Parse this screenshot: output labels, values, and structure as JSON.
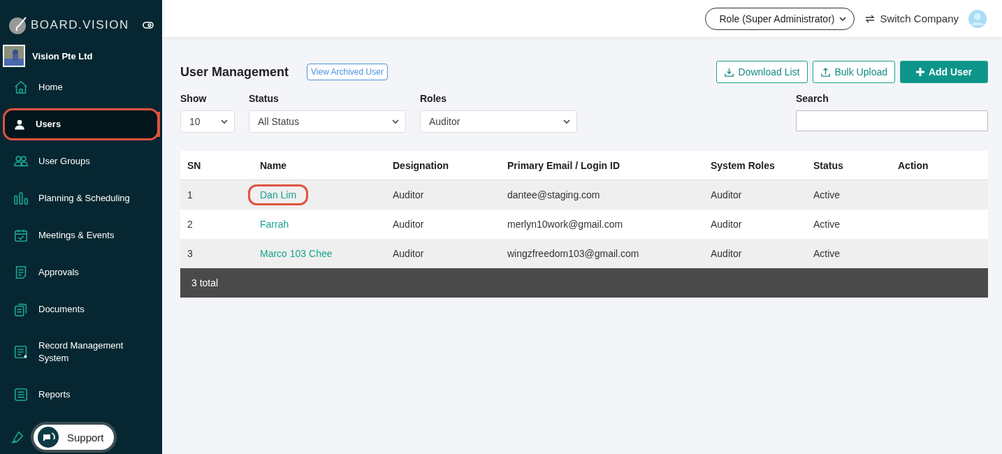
{
  "sidebar": {
    "brand": "BOARD.VISION",
    "company": "Vision Pte Ltd",
    "items": [
      {
        "label": "Home",
        "selected": false,
        "highlighted": false
      },
      {
        "label": "Users",
        "selected": true,
        "highlighted": true
      },
      {
        "label": "User Groups",
        "selected": false,
        "highlighted": false
      },
      {
        "label": "Planning & Scheduling",
        "selected": false,
        "highlighted": false
      },
      {
        "label": "Meetings & Events",
        "selected": false,
        "highlighted": false
      },
      {
        "label": "Approvals",
        "selected": false,
        "highlighted": false
      },
      {
        "label": "Documents",
        "selected": false,
        "highlighted": false
      },
      {
        "label": "Record Management System",
        "selected": false,
        "highlighted": false
      },
      {
        "label": "Reports",
        "selected": false,
        "highlighted": false
      }
    ],
    "support": "Support"
  },
  "header": {
    "role": "Role (Super Administrator)",
    "switch": "Switch Company"
  },
  "page": {
    "title": "User Management",
    "archived_link": "View Archived User",
    "buttons": [
      {
        "label": "Download List",
        "kind": "download"
      },
      {
        "label": "Bulk Upload",
        "kind": "upload"
      },
      {
        "label": "Add User",
        "kind": "add"
      }
    ],
    "filters": [
      {
        "label": "Show",
        "value": "10",
        "kind": "small"
      },
      {
        "label": "Status",
        "value": "All Status",
        "kind": "wide"
      },
      {
        "label": "Roles",
        "value": "Auditor",
        "kind": "wide"
      }
    ],
    "search": {
      "label": "Search"
    }
  },
  "table": {
    "columns": [
      "SN",
      "Name",
      "Designation",
      "Primary Email / Login ID",
      "System Roles",
      "Status",
      "Action"
    ],
    "rows": [
      {
        "sn": "1",
        "name": "Dan Lim",
        "designation": "Auditor",
        "email": "dantee@staging.com",
        "role": "Auditor",
        "status": "Active",
        "highlighted": true
      },
      {
        "sn": "2",
        "name": "Farrah",
        "designation": "Auditor",
        "email": "merlyn10work@gmail.com",
        "role": "Auditor",
        "status": "Active",
        "highlighted": false
      },
      {
        "sn": "3",
        "name": "Marco 103 Chee",
        "designation": "Auditor",
        "email": "wingzfreedom103@gmail.com",
        "role": "Auditor",
        "status": "Active",
        "highlighted": false
      }
    ],
    "footer": "3 total"
  }
}
